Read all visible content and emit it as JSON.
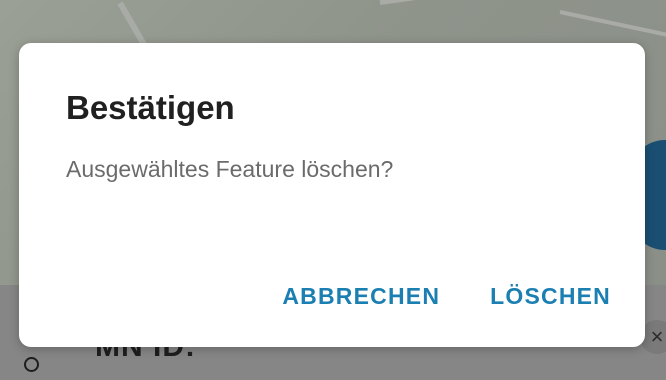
{
  "dialog": {
    "title": "Bestätigen",
    "message": "Ausgewähltes Feature löschen?",
    "cancel_label": "ABBRECHEN",
    "confirm_label": "LÖSCHEN"
  },
  "background": {
    "sheet_title_partial": "MN ID:",
    "close_glyph": "×"
  },
  "colors": {
    "dialog_background": "#ffffff",
    "title_text": "#202020",
    "message_text": "#6b6b6b",
    "button_text": "#1b7fb2",
    "scrim": "#8d8f8a"
  }
}
